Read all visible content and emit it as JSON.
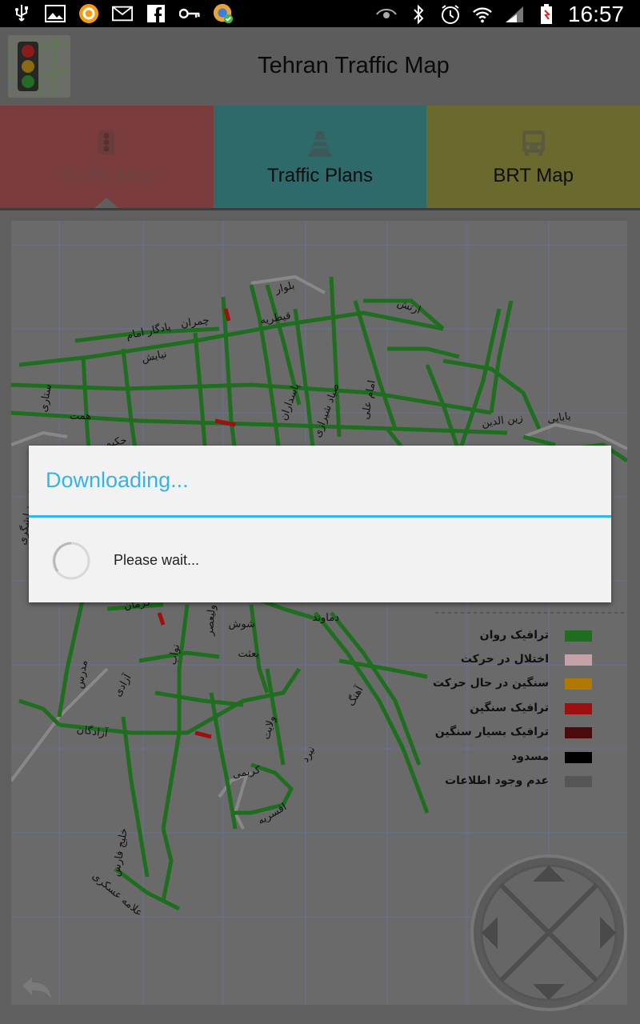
{
  "status_bar": {
    "time": "16:57",
    "left_icons": [
      "usb-icon",
      "gallery-icon",
      "sync-app-icon",
      "gmail-icon",
      "facebook-icon",
      "key-icon",
      "chrome-update-icon"
    ],
    "right_icons": [
      "eye-icon",
      "bluetooth-icon",
      "alarm-icon",
      "wifi-icon",
      "signal-icon",
      "battery-icon"
    ]
  },
  "app": {
    "title": "Tehran Traffic Map",
    "logo_icon": "traffic-light-icon"
  },
  "tabs": [
    {
      "label": "Traffic Map",
      "icon": "traffic-light-icon",
      "color": "#7a3c3c",
      "active": true
    },
    {
      "label": "Traffic Plans",
      "icon": "traffic-cone-icon",
      "color": "#2e6a6a",
      "active": false
    },
    {
      "label": "BRT Map",
      "icon": "bus-icon",
      "color": "#6a6a2e",
      "active": false
    }
  ],
  "map": {
    "street_labels": [
      "بلوار",
      "ارتش",
      "قیطریه",
      "یادگار امام",
      "چمران",
      "نیایش",
      "پاسداران",
      "صیاد شیرازی",
      "امام علی",
      "ستاری",
      "همت",
      "حکیم",
      "زین الدین",
      "بابایی",
      "شوش",
      "آزادگان",
      "کرمان",
      "ولیعصر",
      "آزادی",
      "نواب",
      "بعثت",
      "افسریه",
      "دماوند",
      "مدرس",
      "شهید لشگری",
      "آهنگ",
      "کریمی",
      "نبرد",
      "ولایت",
      "خلیج فارس",
      "علامه عسکری"
    ],
    "legend": [
      {
        "label": "ترافیک روان",
        "color": "#1f6e1f"
      },
      {
        "label": "اختلال در حرکت",
        "color": "#c4a2a8"
      },
      {
        "label": "سنگین در حال حرکت",
        "color": "#b07800"
      },
      {
        "label": "ترافیک سنگین",
        "color": "#9e0f0f"
      },
      {
        "label": "ترافیک بسیار سنگین",
        "color": "#4d0a0a"
      },
      {
        "label": "مسدود",
        "color": "#000000"
      },
      {
        "label": "عدم وجود اطلاعات",
        "color": "#555555"
      }
    ]
  },
  "dialog": {
    "title": "Downloading...",
    "message": "Please wait..."
  },
  "controls": {
    "back_icon": "back-arrow-icon",
    "dpad_icon": "dpad-icon"
  },
  "colors": {
    "accent": "#33b5e5",
    "overlay": "#5f5f5f"
  }
}
